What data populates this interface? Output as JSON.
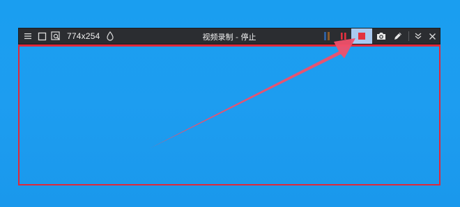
{
  "toolbar": {
    "dimensions": "774x254",
    "title": "视频录制 - 停止",
    "icons": {
      "menu": "menu-icon",
      "select": "square-select-icon",
      "zoom": "zoom-frame-icon",
      "drop": "water-drop-icon",
      "bars": "color-bars-icon",
      "pause": "pause-icon",
      "stop": "stop-icon",
      "camera": "camera-icon",
      "pen": "pen-icon",
      "collapse": "double-chevron-down-icon",
      "close": "close-icon"
    }
  },
  "colors": {
    "desktop": "#1d9df0",
    "toolbar": "#2b2d31",
    "frame": "#e0283a",
    "stop_highlight": "#a9c9f0",
    "arrow": "#f0506a"
  }
}
